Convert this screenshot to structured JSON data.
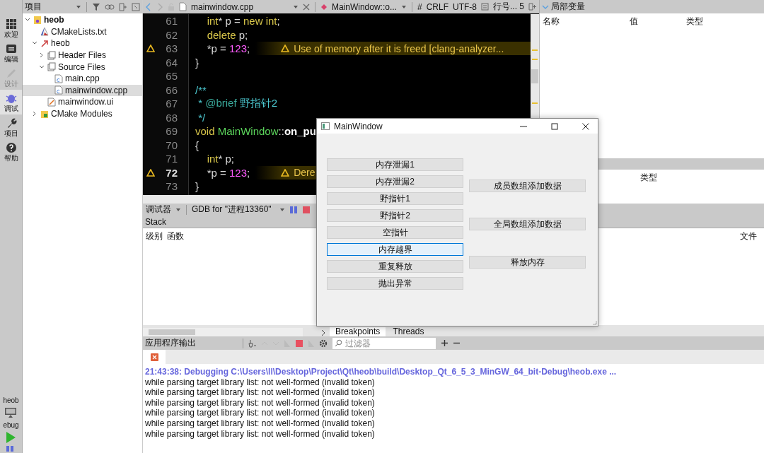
{
  "mode_bar": {
    "items": [
      {
        "label": "欢迎",
        "kind": "grid",
        "selected": false,
        "disabled": false
      },
      {
        "label": "编辑",
        "kind": "edit",
        "selected": false,
        "disabled": false
      },
      {
        "label": "设计",
        "kind": "pen",
        "selected": false,
        "disabled": true
      },
      {
        "label": "调试",
        "kind": "bug",
        "selected": true,
        "disabled": false
      },
      {
        "label": "项目",
        "kind": "wrench",
        "selected": false,
        "disabled": false
      },
      {
        "label": "帮助",
        "kind": "help",
        "selected": false,
        "disabled": false
      }
    ],
    "target": {
      "project": "heob",
      "build": "ebug"
    }
  },
  "project_panel": {
    "title": "项目",
    "tree": [
      {
        "label": "heob",
        "kind": "project",
        "expanded": true,
        "selected": false,
        "children": [
          {
            "label": "CMakeLists.txt",
            "kind": "cmake",
            "selected": false
          },
          {
            "label": "heob",
            "kind": "target",
            "expanded": true,
            "selected": false,
            "children": [
              {
                "label": "Header Files",
                "kind": "folder",
                "expanded": false,
                "selected": false
              },
              {
                "label": "Source Files",
                "kind": "folder",
                "expanded": true,
                "selected": false,
                "children": [
                  {
                    "label": "main.cpp",
                    "kind": "cpp",
                    "selected": false
                  },
                  {
                    "label": "mainwindow.cpp",
                    "kind": "cpp",
                    "selected": true
                  }
                ]
              },
              {
                "label": "mainwindow.ui",
                "kind": "ui",
                "selected": false
              }
            ]
          },
          {
            "label": "CMake Modules",
            "kind": "modules",
            "expanded": false,
            "selected": false
          }
        ]
      }
    ]
  },
  "editor": {
    "toolbar": {
      "file": "mainwindow.cpp",
      "symbol": "MainWindow::o...",
      "hash": "#",
      "line_ending": "CRLF",
      "encoding": "UTF-8",
      "position": "行号... 5"
    },
    "lines": [
      {
        "number": "61",
        "warning": false,
        "current": false,
        "tokens": [
          {
            "kind": "keyword",
            "text": "    int"
          },
          {
            "kind": "plain",
            "text": "* p = "
          },
          {
            "kind": "keyword",
            "text": "new int"
          },
          {
            "kind": "plain",
            "text": ";"
          }
        ]
      },
      {
        "number": "62",
        "warning": false,
        "current": false,
        "tokens": [
          {
            "kind": "keyword",
            "text": "    delete"
          },
          {
            "kind": "plain",
            "text": " p;"
          }
        ]
      },
      {
        "number": "63",
        "warning": true,
        "current": false,
        "tokens": [
          {
            "kind": "plain",
            "text": "    *p = "
          },
          {
            "kind": "number",
            "text": "123"
          },
          {
            "kind": "plain",
            "text": ";"
          }
        ],
        "annotation": "Use of memory after it is freed [clang-analyzer..."
      },
      {
        "number": "64",
        "warning": false,
        "current": false,
        "tokens": [
          {
            "kind": "plain",
            "text": "}"
          }
        ]
      },
      {
        "number": "65",
        "warning": false,
        "current": false
      },
      {
        "number": "66",
        "warning": false,
        "current": false,
        "tokens": [
          {
            "kind": "comment",
            "text": "/**"
          }
        ]
      },
      {
        "number": "67",
        "warning": false,
        "current": false,
        "tokens": [
          {
            "kind": "comment",
            "text": " * "
          },
          {
            "kind": "doctag",
            "text": "@brief"
          },
          {
            "kind": "comment",
            "text": " 野指针2"
          }
        ]
      },
      {
        "number": "68",
        "warning": false,
        "current": false,
        "tokens": [
          {
            "kind": "comment",
            "text": " */"
          }
        ]
      },
      {
        "number": "69",
        "warning": false,
        "current": false,
        "tokens": [
          {
            "kind": "keyword",
            "text": "void "
          },
          {
            "kind": "class",
            "text": "MainWindow"
          },
          {
            "kind": "plain",
            "text": "::"
          },
          {
            "kind": "function",
            "text": "on_pu"
          }
        ]
      },
      {
        "number": "70",
        "warning": false,
        "current": false,
        "tokens": [
          {
            "kind": "plain",
            "text": "{"
          }
        ]
      },
      {
        "number": "71",
        "warning": false,
        "current": false,
        "tokens": [
          {
            "kind": "keyword",
            "text": "    int"
          },
          {
            "kind": "plain",
            "text": "* p;"
          }
        ]
      },
      {
        "number": "72",
        "warning": true,
        "current": true,
        "tokens": [
          {
            "kind": "plain",
            "text": "    *p = "
          },
          {
            "kind": "number",
            "text": "123"
          },
          {
            "kind": "plain",
            "text": ";"
          }
        ],
        "annotation": "Dere"
      },
      {
        "number": "73",
        "warning": false,
        "current": false,
        "tokens": [
          {
            "kind": "plain",
            "text": "}"
          }
        ]
      }
    ]
  },
  "locals": {
    "title": "局部变量",
    "columns": [
      "名称",
      "值",
      "类型"
    ]
  },
  "expressions": {
    "columns": [
      "类型"
    ]
  },
  "debugger": {
    "label": "调试器",
    "engine": "GDB for \"进程13360\"",
    "stack_title": "Stack",
    "columns": [
      "级别",
      "函数"
    ],
    "file_column": "文件",
    "tabs": [
      {
        "label": "Breakpoints",
        "selected": true
      },
      {
        "label": "Threads",
        "selected": false
      }
    ]
  },
  "output": {
    "title": "应用程序输出",
    "filter_placeholder": "过滤器",
    "lines": [
      {
        "kind": "info",
        "text": "21:43:38: Debugging C:\\Users\\ll\\Desktop\\Project\\Qt\\heob\\build\\Desktop_Qt_6_5_3_MinGW_64_bit-Debug\\heob.exe ..."
      },
      {
        "kind": "plain",
        "text": "while parsing target library list: not well-formed (invalid token)"
      },
      {
        "kind": "plain",
        "text": "while parsing target library list: not well-formed (invalid token)"
      },
      {
        "kind": "plain",
        "text": "while parsing target library list: not well-formed (invalid token)"
      },
      {
        "kind": "plain",
        "text": "while parsing target library list: not well-formed (invalid token)"
      },
      {
        "kind": "plain",
        "text": "while parsing target library list: not well-formed (invalid token)"
      },
      {
        "kind": "plain",
        "text": "while parsing target library list: not well-formed (invalid token)"
      }
    ]
  },
  "app_window": {
    "title": "MainWindow",
    "left_buttons": [
      {
        "label": "内存泄漏1",
        "focused": false
      },
      {
        "label": "内存泄漏2",
        "focused": false
      },
      {
        "label": "野指针1",
        "focused": false
      },
      {
        "label": "野指针2",
        "focused": false
      },
      {
        "label": "空指针",
        "focused": false
      },
      {
        "label": "内存越界",
        "focused": true
      },
      {
        "label": "重复释放",
        "focused": false
      },
      {
        "label": "抛出异常",
        "focused": false
      }
    ],
    "right_buttons": [
      {
        "label": "成员数组添加数据",
        "focused": false
      },
      {
        "label": "全局数组添加数据",
        "focused": false
      },
      {
        "label": "释放内存",
        "focused": false
      }
    ]
  }
}
